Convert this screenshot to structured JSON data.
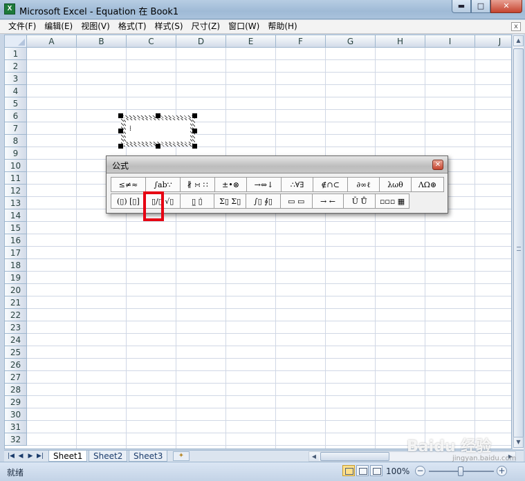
{
  "window": {
    "title": "Microsoft Excel - Equation 在 Book1",
    "icon_label": "X",
    "minimize": "▬",
    "maximize": "□",
    "close": "✕"
  },
  "menu": [
    "文件(F)",
    "编辑(E)",
    "视图(V)",
    "格式(T)",
    "样式(S)",
    "尺寸(Z)",
    "窗口(W)",
    "帮助(H)"
  ],
  "doc_close": "x",
  "columns": [
    "A",
    "B",
    "C",
    "D",
    "E",
    "F",
    "G",
    "H",
    "I",
    "J"
  ],
  "rows": [
    "1",
    "2",
    "3",
    "4",
    "5",
    "6",
    "7",
    "8",
    "9",
    "10",
    "11",
    "12",
    "13",
    "14",
    "15",
    "16",
    "17",
    "18",
    "19",
    "20",
    "21",
    "22",
    "23",
    "24",
    "25",
    "26",
    "27",
    "28",
    "29",
    "30",
    "31",
    "32"
  ],
  "equation_editor": {
    "title": "公式",
    "close": "✕",
    "row1": [
      "≤≠≈",
      "∫ab∵",
      "∦ ∺ ∷",
      "±•⊗",
      "→⇔↓",
      "∴∀∃",
      "∉∩⊂",
      "∂∞ℓ",
      "λωθ",
      "ΛΩ⊛"
    ],
    "row2": [
      "(▯) [▯]",
      "▯/▯ √▯",
      "▯̲ ▯̇",
      "Σ▯ Σ▯",
      "∫▯ ∮▯",
      "▭ ▭",
      "→ ←",
      "Ū Ů",
      "▫▫▫ ▦"
    ],
    "input_cursor": "⁞"
  },
  "sheets": {
    "nav": [
      "|◀",
      "◀",
      "▶",
      "▶|"
    ],
    "tabs": [
      "Sheet1",
      "Sheet2",
      "Sheet3"
    ],
    "active": "Sheet1",
    "new_sheet_icon": "new-sheet-icon"
  },
  "status": {
    "ready_text": "就绪",
    "zoom": "100%",
    "zoom_minus": "−",
    "zoom_plus": "+"
  },
  "watermark": {
    "text": "Baidu 经验",
    "sub": "jingyan.baidu.com"
  },
  "colors": {
    "highlight": "#e60012",
    "active_tab": "#ffffff"
  }
}
